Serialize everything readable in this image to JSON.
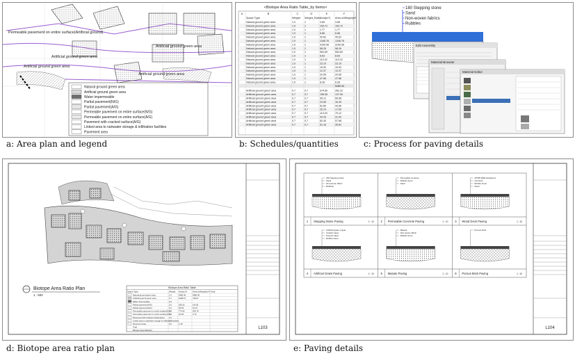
{
  "captions": {
    "a": "a: Area plan and legend",
    "b": "b: Schedules/quantities",
    "c": "c: Process for paving details",
    "d": "d: Biotope area ratio plan",
    "e": "e: Paving details"
  },
  "panel_a": {
    "plan_labels": [
      "Permeable pavement on entire surface(Artificial ground)",
      "Artificial ground green area",
      "Artificial ground green area",
      "Artificial ground green area",
      "Artificial ground green area"
    ],
    "legend": [
      {
        "label": "Natural ground green area",
        "color": "#ffffff"
      },
      {
        "label": "Artificial ground green area",
        "color": "#d9d9d9"
      },
      {
        "label": "Water impermeable",
        "color": "#6d6d6d"
      },
      {
        "label": "Partial pavement(N/G)",
        "color": "#ffffff"
      },
      {
        "label": "Partial pavement(A/G)",
        "color": "#e6e6e6"
      },
      {
        "label": "Permeable pavement on entire surface(N/G)",
        "color": "#ffffff"
      },
      {
        "label": "Permeable pavement on entire surface(A/G)",
        "color": "#ebebeb"
      },
      {
        "label": "Pavement with cracked surface(A/G)",
        "color": "#ffffff"
      },
      {
        "label": "Linked area to rainwater storage & infiltration facilities",
        "color": "#ffffff"
      },
      {
        "label": "Pavement area",
        "color": "#ffffff"
      }
    ]
  },
  "panel_b": {
    "title": "<Biotope Area Ratio Table_by Items>",
    "col_letters": [
      "A",
      "B",
      "C",
      "D",
      "E",
      "F"
    ],
    "headers": [
      "Space Type",
      "Weight",
      "Weight_Ratio",
      "Area(m²)",
      "Area w/Weight(m²)"
    ],
    "rows": [
      [
        "Natural ground green area",
        "1.0",
        "1",
        "3.85",
        "3.85"
      ],
      [
        "Natural ground green area",
        "1.0",
        "1",
        "153.72",
        "153.72"
      ],
      [
        "Natural ground green area",
        "1.0",
        "1",
        "1.77",
        "1.77"
      ],
      [
        "Natural ground green area",
        "1.0",
        "1",
        "6.86",
        "6.86"
      ],
      [
        "Natural ground green area",
        "1.0",
        "1",
        "40.62",
        "40.62"
      ],
      [
        "Natural ground green area",
        "1.0",
        "1",
        "1346.76",
        "1346.76"
      ],
      [
        "Natural ground green area",
        "1.0",
        "1",
        "3190.96",
        "3190.96"
      ],
      [
        "Natural ground green area",
        "1.0",
        "1",
        "58.26",
        "58.26"
      ],
      [
        "Natural ground green area",
        "1.0",
        "1",
        "553.69",
        "553.69"
      ],
      [
        "Natural ground green area",
        "1.0",
        "1",
        "8.63",
        "8.63"
      ],
      [
        "Natural ground green area",
        "1.0",
        "1",
        "113.22",
        "113.22"
      ],
      [
        "Natural ground green area",
        "1.0",
        "1",
        "23.10",
        "23.10"
      ],
      [
        "Natural ground green area",
        "1.0",
        "1",
        "15.92",
        "15.92"
      ],
      [
        "Natural ground green area",
        "1.0",
        "1",
        "12.37",
        "12.37"
      ],
      [
        "Natural ground green area",
        "1.0",
        "1",
        "20.55",
        "20.55"
      ],
      [
        "Natural ground green area",
        "1.0",
        "1",
        "47.66",
        "47.66"
      ],
      [
        "Natural ground green area",
        "1.0",
        "1",
        "8.28",
        "8.28"
      ]
    ],
    "subtotal": "5480.40",
    "rows2": [
      [
        "Artificial ground green area",
        "0.7",
        "0.7",
        "374.60",
        "262.22"
      ],
      [
        "Artificial ground green area",
        "0.7",
        "0.7",
        "196.55",
        "137.59"
      ],
      [
        "Artificial ground green area",
        "0.7",
        "0.7",
        "95.12",
        "66.58"
      ],
      [
        "Artificial ground green area",
        "0.7",
        "0.7",
        "23.55",
        "16.49"
      ],
      [
        "Artificial ground green area",
        "0.7",
        "0.7",
        "62.80",
        "43.96"
      ],
      [
        "Artificial ground green area",
        "0.7",
        "0.7",
        "25.14",
        "17.60"
      ],
      [
        "Artificial ground green area",
        "0.7",
        "0.7",
        "113.03",
        "79.12"
      ],
      [
        "Artificial ground green area",
        "0.7",
        "0.7",
        "44.29",
        "31.00"
      ],
      [
        "Artificial ground green area",
        "0.7",
        "0.7",
        "82.40",
        "57.68"
      ],
      [
        "Artificial ground green area",
        "0.7",
        "0.7",
        "51.16",
        "35.81"
      ]
    ]
  },
  "panel_c": {
    "layers": [
      "180 Stepping stone",
      "Sand",
      "Non-woven fabrics",
      "Rubbles"
    ],
    "dialog_titles": [
      "Edit Assembly",
      "Material Browser",
      "Material Editor"
    ]
  },
  "panel_d": {
    "plan_title": "Biotope Area Ratio Plan",
    "scale": "1 : 500",
    "sheet_number": "L103",
    "table_title": "Biotope Area Ratio Table",
    "table_headers": [
      "Space Type",
      "Weight",
      "Area(m²)",
      "Area w/Weight(m²)",
      "Total"
    ],
    "table_rows": [
      [
        "Natural ground green area",
        "1.0",
        "5480.40",
        "5480.40",
        ""
      ],
      [
        "Artificial ground green area",
        "0.7",
        "1068.67",
        "748.07",
        ""
      ],
      [
        "Water impermeable",
        "0.0",
        "",
        "",
        ""
      ],
      [
        "Partial pavement(N/G)",
        "0.5",
        "285.62",
        "142.81",
        ""
      ],
      [
        "Partial pavement(A/G)",
        "0.3",
        "53.56",
        "16.07",
        ""
      ],
      [
        "Permeable pavement on entire surface(N/G)",
        "0.4",
        "774.46",
        "309.78",
        ""
      ],
      [
        "Permeable pavement on entire surface(A/G)",
        "0.2",
        "23.48",
        "4.70",
        ""
      ],
      [
        "Pavement with cracked surface(A/G)",
        "0.2",
        "",
        "",
        ""
      ],
      [
        "Linked area to rainwater storage & infiltration facilities",
        "0.2",
        "",
        "",
        ""
      ],
      [
        "Pavement area",
        "0.0",
        "1.30",
        "",
        ""
      ],
      [
        "Total",
        "",
        "",
        "",
        ""
      ],
      [
        "Biotope Area Ratio(%)",
        "",
        "",
        "",
        ""
      ]
    ]
  },
  "panel_e": {
    "sheet_number": "L104",
    "details": [
      {
        "num": "1",
        "name": "Stepping Stone Paving",
        "scale": "1 : 10",
        "layers": [
          "180 Stepping stone",
          "Sand",
          "Non-woven fabric",
          "Rubbles"
        ]
      },
      {
        "num": "2",
        "name": "Permeable Concrete Paving",
        "scale": "1 : 10",
        "layers": [
          "Permeable concrete",
          "Rubble stone",
          "Sand"
        ]
      },
      {
        "num": "3",
        "name": "Wood Deck Paving",
        "scale": "1 : 10",
        "layers": [
          "20*95*1800 Hardwood",
          "Concrete",
          "Rubble stone",
          "Sand"
        ]
      },
      {
        "num": "4",
        "name": "Artificial Grass Paving",
        "scale": "1 : 10",
        "layers": [
          "Artificial grass 1 layer",
          "Cushion layer",
          "Polymer layer",
          "Rubble stone"
        ]
      },
      {
        "num": "5",
        "name": "Masato Paving",
        "scale": "1 : 10",
        "layers": [
          "Masato",
          "Non-woven fabric",
          "Rubble stone"
        ]
      },
      {
        "num": "6",
        "name": "Porous Brick Paving",
        "scale": "1 : 10",
        "layers": [
          "Porous brick"
        ]
      }
    ]
  }
}
